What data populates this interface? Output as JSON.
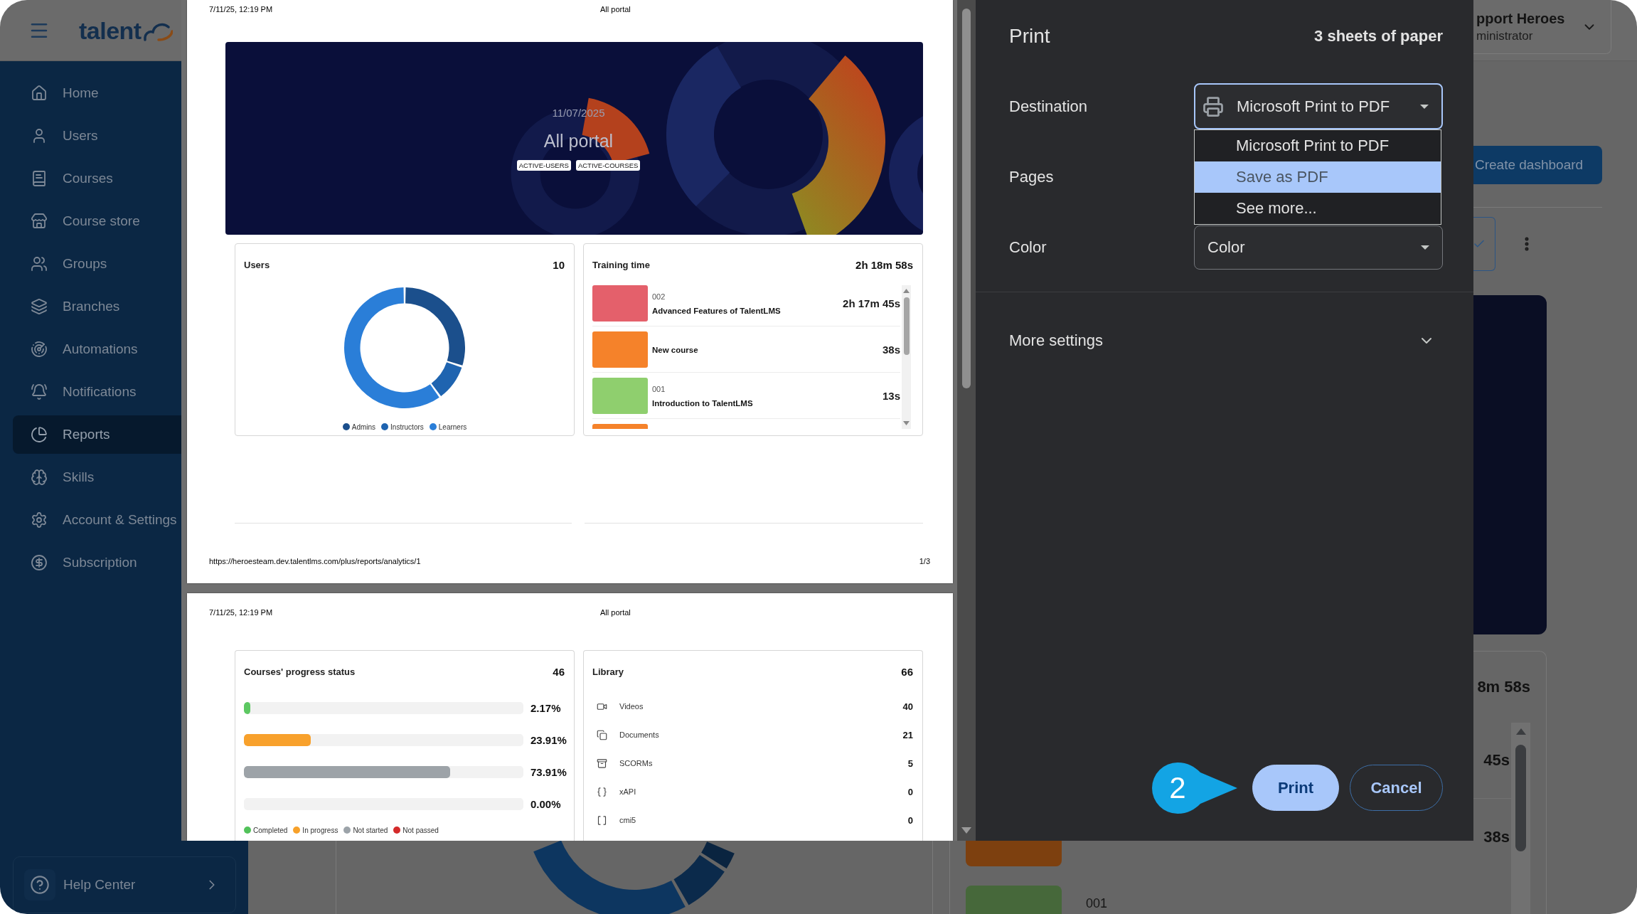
{
  "app": {
    "logo_text": "talent",
    "user": {
      "name": "pport Heroes",
      "role": "ministrator"
    },
    "sidebar": [
      {
        "label": "Home",
        "selected": false
      },
      {
        "label": "Users",
        "selected": false
      },
      {
        "label": "Courses",
        "selected": false
      },
      {
        "label": "Course store",
        "selected": false
      },
      {
        "label": "Groups",
        "selected": false
      },
      {
        "label": "Branches",
        "selected": false
      },
      {
        "label": "Automations",
        "selected": false
      },
      {
        "label": "Notifications",
        "selected": false
      },
      {
        "label": "Reports",
        "selected": true
      },
      {
        "label": "Skills",
        "selected": false
      },
      {
        "label": "Account & Settings",
        "selected": false
      },
      {
        "label": "Subscription",
        "selected": false
      }
    ],
    "help": "Help Center",
    "dashboard": {
      "create_button": "Create dashboard",
      "training_total": "8m 58s",
      "durations": [
        "45s",
        "38s"
      ],
      "course_code": "001"
    }
  },
  "preview": {
    "first_page": {
      "header": {
        "date": "7/11/25, 12:19 PM",
        "title": "All portal"
      },
      "banner": {
        "date": "11/07/2025",
        "title": "All portal",
        "tags": [
          "ACTIVE-USERS",
          "ACTIVE-COURSES"
        ]
      },
      "users_card": {
        "title": "Users",
        "count": "10",
        "legend": [
          {
            "label": "Admins",
            "color": "#1b4f8c"
          },
          {
            "label": "Instructors",
            "color": "#1f64b0"
          },
          {
            "label": "Learners",
            "color": "#2a7ed8"
          }
        ]
      },
      "training_card": {
        "title": "Training time",
        "total": "2h 18m 58s",
        "rows": [
          {
            "code": "002",
            "title": "Advanced Features of TalentLMS",
            "duration": "2h 17m 45s",
            "color": "#e4606b"
          },
          {
            "title": "New course",
            "duration": "38s",
            "color": "#f5822a"
          },
          {
            "code": "001",
            "title": "Introduction to TalentLMS",
            "duration": "13s",
            "color": "#8fcf6e"
          },
          {
            "color": "#f5822a"
          }
        ]
      },
      "footer": {
        "url": "https://heroesteam.dev.talentlms.com/plus/reports/analytics/1",
        "page": "1/3"
      }
    },
    "second_page": {
      "header": {
        "date": "7/11/25, 12:19 PM",
        "title": "All portal"
      },
      "progress_card": {
        "title": "Courses' progress status",
        "count": "46",
        "bars": [
          {
            "level": 0.0217,
            "color": "#5dc862",
            "reading": "2.17%"
          },
          {
            "level": 0.2391,
            "color": "#f8a12c",
            "reading": "23.91%"
          },
          {
            "level": 0.7391,
            "color": "#9da3a8",
            "reading": "73.91%"
          },
          {
            "reading": "0.00%"
          }
        ],
        "legend": [
          {
            "label": "Completed",
            "color": "#52c25a"
          },
          {
            "label": "In progress",
            "color": "#f7a12a"
          },
          {
            "label": "Not started",
            "color": "#9ca3a9"
          },
          {
            "label": "Not passed",
            "color": "#d42a2a"
          }
        ]
      },
      "library_card": {
        "title": "Library",
        "count": "66",
        "rows": [
          {
            "label": "Videos",
            "count": "40"
          },
          {
            "label": "Documents",
            "count": "21"
          },
          {
            "label": "SCORMs",
            "count": "5"
          },
          {
            "label": "xAPI",
            "count": "0"
          },
          {
            "label": "cmi5",
            "count": "0"
          }
        ]
      }
    }
  },
  "print_dialog": {
    "title": "Print",
    "sheets": "3 sheets of paper",
    "settings": [
      {
        "kind": "select_with_icon",
        "label": "Destination",
        "value": "Microsoft Print to PDF",
        "focused": true
      },
      {
        "kind": "label_only",
        "label": "Pages"
      },
      {
        "kind": "select",
        "label": "Color",
        "value": "Color",
        "focused": false
      }
    ],
    "destination_menu": [
      {
        "label": "Microsoft Print to PDF",
        "selected": false
      },
      {
        "label": "Save as PDF",
        "selected": true
      },
      {
        "label": "See more...",
        "selected": false
      }
    ],
    "more_settings": {
      "label": "More settings",
      "expanded": false
    },
    "buttons": [
      {
        "label": "Print",
        "kind": "primary"
      },
      {
        "label": "Cancel",
        "kind": "secondary"
      }
    ]
  },
  "step_marker": "2"
}
